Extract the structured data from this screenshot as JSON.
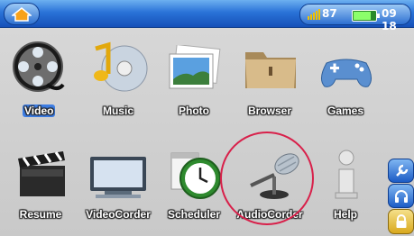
{
  "status": {
    "volume": "87",
    "battery_level": 0.8,
    "time": "09 18"
  },
  "menu": {
    "items": [
      {
        "label": "Video",
        "selected": true
      },
      {
        "label": "Music"
      },
      {
        "label": "Photo"
      },
      {
        "label": "Browser"
      },
      {
        "label": "Games"
      },
      {
        "label": "Resume"
      },
      {
        "label": "VideoCorder"
      },
      {
        "label": "Scheduler"
      },
      {
        "label": "AudioCorder"
      },
      {
        "label": "Help"
      }
    ]
  },
  "side_buttons": [
    "wrench-icon",
    "headphones-icon",
    "lock-icon"
  ],
  "colors": {
    "topbar": "#2a73d8",
    "selection": "#3d7de3",
    "highlight_circle": "#d8204a"
  }
}
